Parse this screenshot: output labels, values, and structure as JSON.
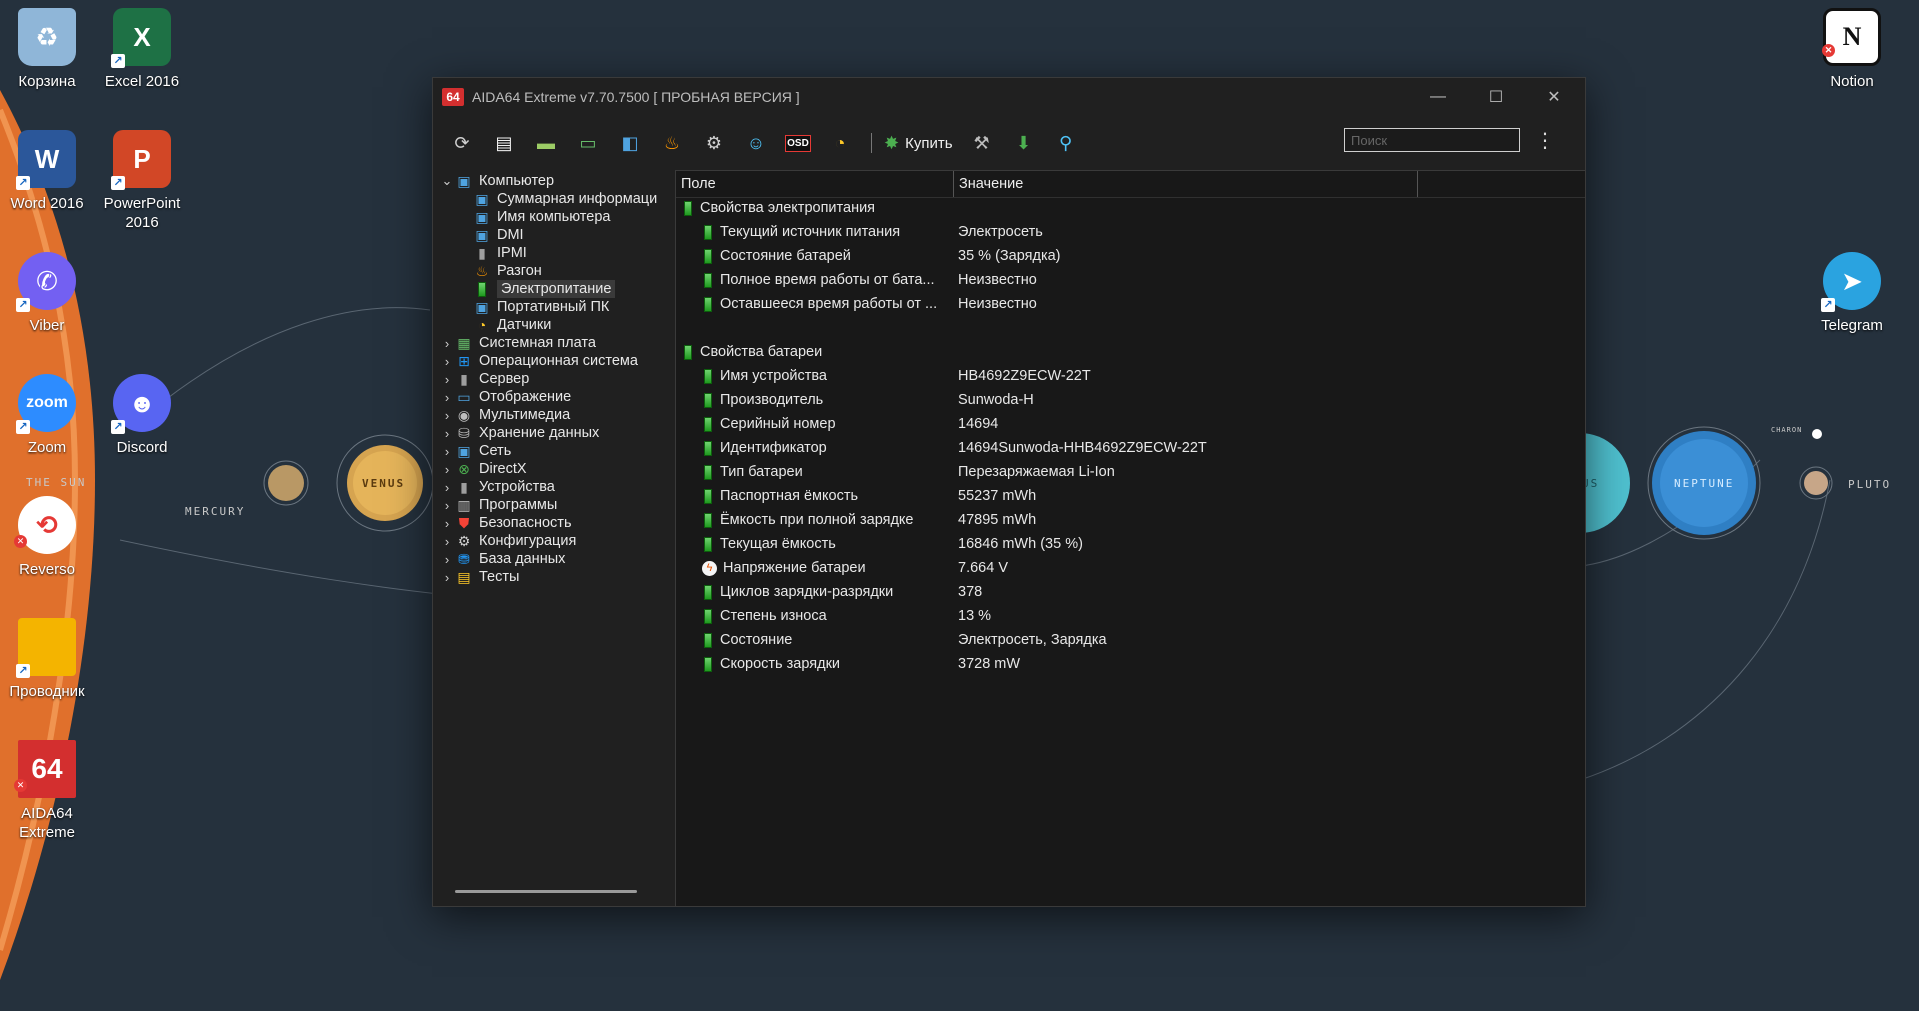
{
  "desktop": {
    "icons_left": [
      {
        "label": "Корзина",
        "icon": "recycle-bin-icon",
        "color": "#8fb6d8"
      },
      {
        "label": "Excel 2016",
        "icon": "excel-icon",
        "color": "#1e7145"
      },
      {
        "label": "Word 2016",
        "icon": "word-icon",
        "color": "#2b579a"
      },
      {
        "label": "PowerPoint 2016",
        "icon": "powerpoint-icon",
        "color": "#d24726"
      },
      {
        "label": "Viber",
        "icon": "viber-icon",
        "color": "#7360f2"
      },
      {
        "label": "Zoom",
        "icon": "zoom-icon",
        "color": "#2d8cff"
      },
      {
        "label": "Discord",
        "icon": "discord-icon",
        "color": "#5865f2"
      },
      {
        "label": "Reverso",
        "icon": "reverso-icon",
        "color": "#e53935"
      },
      {
        "label": "Проводник",
        "icon": "folder-icon",
        "color": "#f4b400"
      },
      {
        "label": "AIDA64 Extreme",
        "icon": "aida64-icon",
        "color": "#d32f2f"
      }
    ],
    "icons_right": [
      {
        "label": "Notion",
        "icon": "notion-icon",
        "color": "#ffffff"
      },
      {
        "label": "Telegram",
        "icon": "telegram-icon",
        "color": "#2aa3e0"
      }
    ],
    "glyphs": {
      "excel": "X",
      "word": "W",
      "powerpoint": "P",
      "zoom": "zoom",
      "notion": "N",
      "aida": "64"
    },
    "wallpaper_labels": {
      "mercury": "MERCURY",
      "venus": "VENUS",
      "sun": "THE SUN",
      "neptune": "NEPTUNE",
      "pluto": "PLUTO",
      "uranus_fragment": "US",
      "charon": "CHARON"
    }
  },
  "window": {
    "logo": "64",
    "title": "AIDA64 Extreme v7.70.7500  [ ПРОБНАЯ ВЕРСИЯ ]",
    "controls": {
      "minimize": "—",
      "maximize": "☐",
      "close": "✕"
    }
  },
  "toolbar": {
    "buy_label": "Купить",
    "search_placeholder": "Поиск",
    "more": "⋮"
  },
  "tree": {
    "root": {
      "label": "Компьютер",
      "icon": "computer-icon"
    },
    "children": [
      {
        "label": "Суммарная информаци",
        "icon": "summary-icon"
      },
      {
        "label": "Имя компьютера",
        "icon": "computer-name-icon"
      },
      {
        "label": "DMI",
        "icon": "dmi-icon"
      },
      {
        "label": "IPMI",
        "icon": "ipmi-icon"
      },
      {
        "label": "Разгон",
        "icon": "overclock-flame-icon"
      },
      {
        "label": "Электропитание",
        "icon": "power-battery-icon",
        "selected": true
      },
      {
        "label": "Портативный ПК",
        "icon": "laptop-icon"
      },
      {
        "label": "Датчики",
        "icon": "sensor-icon"
      }
    ],
    "sections": [
      {
        "label": "Системная плата",
        "icon": "motherboard-icon"
      },
      {
        "label": "Операционная система",
        "icon": "windows-icon"
      },
      {
        "label": "Сервер",
        "icon": "server-icon"
      },
      {
        "label": "Отображение",
        "icon": "display-icon"
      },
      {
        "label": "Мультимедиа",
        "icon": "multimedia-icon"
      },
      {
        "label": "Хранение данных",
        "icon": "storage-icon"
      },
      {
        "label": "Сеть",
        "icon": "network-icon"
      },
      {
        "label": "DirectX",
        "icon": "directx-icon"
      },
      {
        "label": "Устройства",
        "icon": "devices-icon"
      },
      {
        "label": "Программы",
        "icon": "programs-icon"
      },
      {
        "label": "Безопасность",
        "icon": "security-shield-icon"
      },
      {
        "label": "Конфигурация",
        "icon": "config-icon"
      },
      {
        "label": "База данных",
        "icon": "database-icon"
      },
      {
        "label": "Тесты",
        "icon": "tests-icon"
      }
    ]
  },
  "list": {
    "columns": {
      "field": "Поле",
      "value": "Значение"
    },
    "groups": [
      {
        "title": "Свойства электропитания",
        "rows": [
          {
            "field": "Текущий источник питания",
            "value": "Электросеть"
          },
          {
            "field": "Состояние батарей",
            "value": "35 % (Зарядка)"
          },
          {
            "field": "Полное время работы от бата...",
            "value": "Неизвестно"
          },
          {
            "field": "Оставшееся время работы от ...",
            "value": "Неизвестно"
          }
        ]
      },
      {
        "title": "Свойства батареи",
        "rows": [
          {
            "field": "Имя устройства",
            "value": "HB4692Z9ECW-22T"
          },
          {
            "field": "Производитель",
            "value": "Sunwoda-H"
          },
          {
            "field": "Серийный номер",
            "value": "14694"
          },
          {
            "field": "Идентификатор",
            "value": "14694Sunwoda-HHB4692Z9ECW-22T"
          },
          {
            "field": "Тип батареи",
            "value": "Перезаряжаемая Li-Ion"
          },
          {
            "field": "Паспортная ёмкость",
            "value": "55237 mWh"
          },
          {
            "field": "Ёмкость при полной зарядке",
            "value": "47895 mWh"
          },
          {
            "field": "Текущая ёмкость",
            "value": "16846 mWh  (35 %)"
          },
          {
            "field": "Напряжение батареи",
            "value": "7.664 V",
            "icon": "voltage-icon"
          },
          {
            "field": "Циклов зарядки-разрядки",
            "value": "378"
          },
          {
            "field": "Степень износа",
            "value": "13 %"
          },
          {
            "field": "Состояние",
            "value": "Электросеть, Зарядка"
          },
          {
            "field": "Скорость зарядки",
            "value": "3728 mW"
          }
        ]
      }
    ]
  }
}
